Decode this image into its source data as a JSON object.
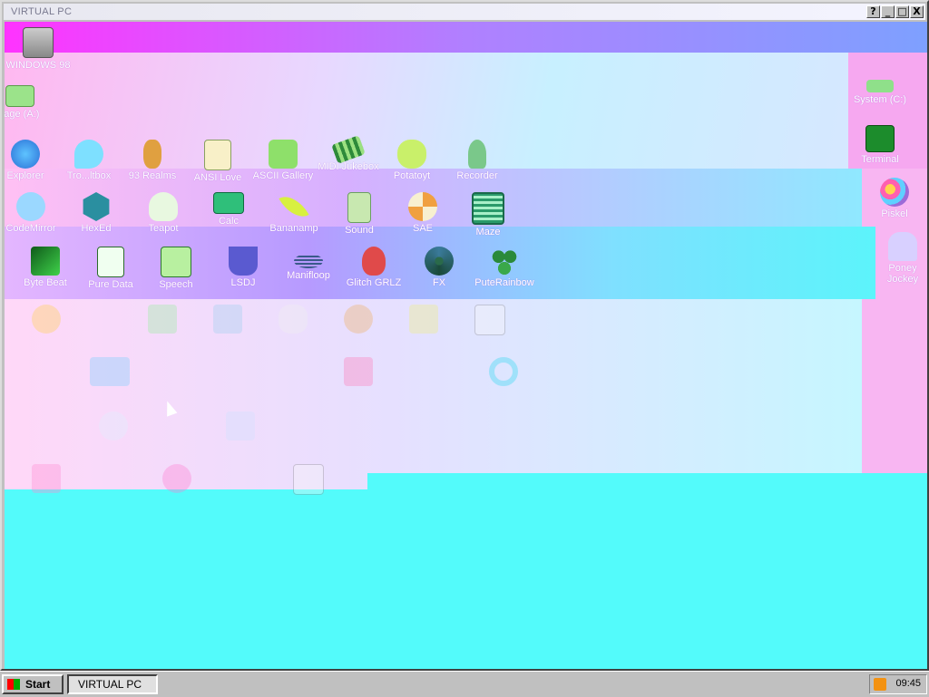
{
  "window": {
    "title": "VIRTUAL PC",
    "buttons": [
      "?",
      "_",
      "□",
      "X"
    ]
  },
  "desktop": {
    "left_icons": [
      {
        "label": "WINDOWS 98",
        "icon": "monitor-icon"
      },
      {
        "label": "rage (A:)",
        "icon": "floppy-drive-icon"
      }
    ],
    "right_icons": [
      {
        "label": "System (C:)",
        "icon": "hard-drive-icon"
      },
      {
        "label": "Terminal",
        "icon": "terminal-icon"
      },
      {
        "label": "Piskel",
        "icon": "palette-icon"
      },
      {
        "label": "Poney Jockey",
        "icon": "pony-icon"
      }
    ],
    "row1": [
      {
        "label": "Explorer",
        "icon": "globe-icon"
      },
      {
        "label": "Tro...ltbox",
        "icon": "chat-icon"
      },
      {
        "label": "93 Realms",
        "icon": "dwarf-icon"
      },
      {
        "label": "ANSI Love",
        "icon": "ansi-icon"
      },
      {
        "label": "ASCII Gallery",
        "icon": "number-icon"
      },
      {
        "label": "MIDI Jukebox",
        "icon": "piano-icon"
      },
      {
        "label": "Potatoyt",
        "icon": "potato-icon"
      },
      {
        "label": "Recorder",
        "icon": "microphone-icon"
      }
    ],
    "row2": [
      {
        "label": "CodeMirror",
        "icon": "codemirror-icon"
      },
      {
        "label": "HexEd",
        "icon": "hexagon-icon"
      },
      {
        "label": "Teapot",
        "icon": "teapot-icon"
      },
      {
        "label": "Calc",
        "icon": "calculator-icon"
      },
      {
        "label": "Bananamp",
        "icon": "banana-icon"
      },
      {
        "label": "Sound",
        "icon": "sound-icon"
      },
      {
        "label": "SAE",
        "icon": "ball-icon"
      },
      {
        "label": "Maze",
        "icon": "maze-icon"
      }
    ],
    "row3": [
      {
        "label": "Byte Beat",
        "icon": "bytebeat-icon"
      },
      {
        "label": "Pure Data",
        "icon": "puredata-icon"
      },
      {
        "label": "Speech",
        "icon": "speech-icon"
      },
      {
        "label": "LSDJ",
        "icon": "lsdj-icon"
      },
      {
        "label": "Manifloop",
        "icon": "wave-icon"
      },
      {
        "label": "Glitch GRLZ",
        "icon": "lips-icon"
      },
      {
        "label": "FX",
        "icon": "atom-icon"
      },
      {
        "label": "PuteRainbow",
        "icon": "frogs-icon"
      }
    ]
  },
  "taskbar": {
    "start_label": "Start",
    "task_label": "VIRTUAL PC",
    "clock": "09:45"
  },
  "colors": {
    "desktop": "#53fbfb",
    "accent_magenta": "#ff44ff",
    "glitch_purple": "#c79cf0"
  }
}
